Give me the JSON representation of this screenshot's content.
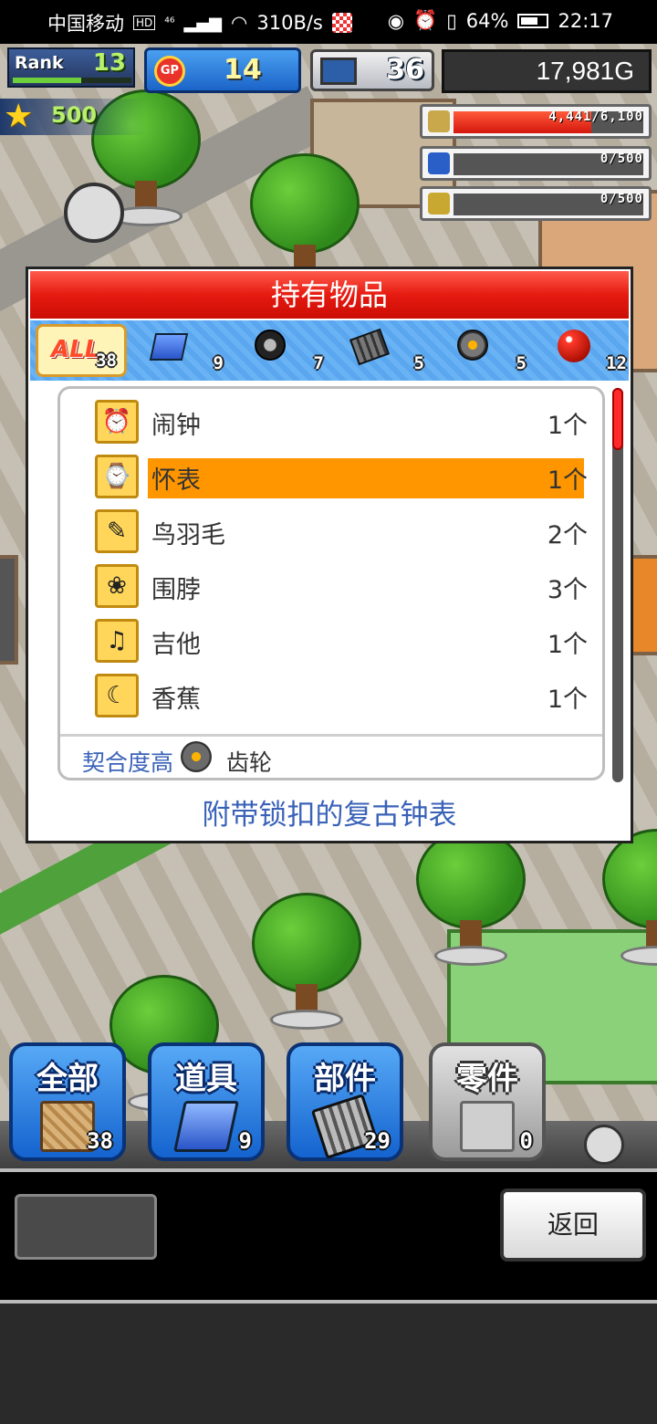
{
  "status_bar": {
    "carrier": "中国移动",
    "hd": "HD",
    "network": "⁴⁶",
    "speed": "310B/s",
    "battery": "64%",
    "time": "22:17"
  },
  "hud": {
    "rank_label": "Rank",
    "rank_value": "13",
    "rank_progress": 0.58,
    "gp_label": "GP",
    "gp_value": "14",
    "pc_value": "36",
    "money": "17,981G",
    "star_value": "500",
    "resources": [
      {
        "icon": "coin-stack-icon",
        "text": "4,441/6,100",
        "fill": 0.728
      },
      {
        "icon": "bottle-icon",
        "text": "0/500",
        "fill": 0
      },
      {
        "icon": "wheat-icon",
        "text": "0/500",
        "fill": 0
      }
    ]
  },
  "dialog": {
    "title": "持有物品",
    "tabs": [
      {
        "key": "all",
        "label": "ALL",
        "count": "38",
        "active": true
      },
      {
        "key": "tools",
        "icon": "book-stack-icon",
        "count": "9"
      },
      {
        "key": "tires",
        "icon": "tire-icon",
        "count": "7"
      },
      {
        "key": "engine",
        "icon": "engine-icon",
        "count": "5"
      },
      {
        "key": "gear",
        "icon": "gear-icon",
        "count": "5"
      },
      {
        "key": "ball",
        "icon": "red-ball-icon",
        "count": "12"
      }
    ],
    "items": [
      {
        "name": "闹钟",
        "qty": "1个",
        "icon": "alarm-clock-icon",
        "glyph": "⏰",
        "selected": false
      },
      {
        "name": "怀表",
        "qty": "1个",
        "icon": "pocket-watch-icon",
        "glyph": "⌚",
        "selected": true
      },
      {
        "name": "鸟羽毛",
        "qty": "2个",
        "icon": "feather-icon",
        "glyph": "✎",
        "selected": false
      },
      {
        "name": "围脖",
        "qty": "3个",
        "icon": "scarf-icon",
        "glyph": "❀",
        "selected": false
      },
      {
        "name": "吉他",
        "qty": "1个",
        "icon": "guitar-icon",
        "glyph": "♫",
        "selected": false
      },
      {
        "name": "香蕉",
        "qty": "1个",
        "icon": "banana-icon",
        "glyph": "☾",
        "selected": false
      }
    ],
    "compat_label": "契合度高",
    "compat_item": "齿轮",
    "description": "附带锁扣的复古钟表"
  },
  "categories": [
    {
      "label": "全部",
      "count": "38",
      "icon": "crate-icon",
      "style": "blue"
    },
    {
      "label": "道具",
      "count": "9",
      "icon": "book-stack-icon",
      "style": "blue"
    },
    {
      "label": "部件",
      "count": "29",
      "icon": "engine-parts-icon",
      "style": "blue"
    },
    {
      "label": "零件",
      "count": "0",
      "icon": "car-part-icon",
      "style": "grey"
    }
  ],
  "bottom": {
    "back_label": "返回"
  },
  "colors": {
    "title_red": "#e61a10",
    "selected_orange": "#ff9600",
    "link_blue": "#3a62b8",
    "tab_blue": "#5aa6ef"
  }
}
